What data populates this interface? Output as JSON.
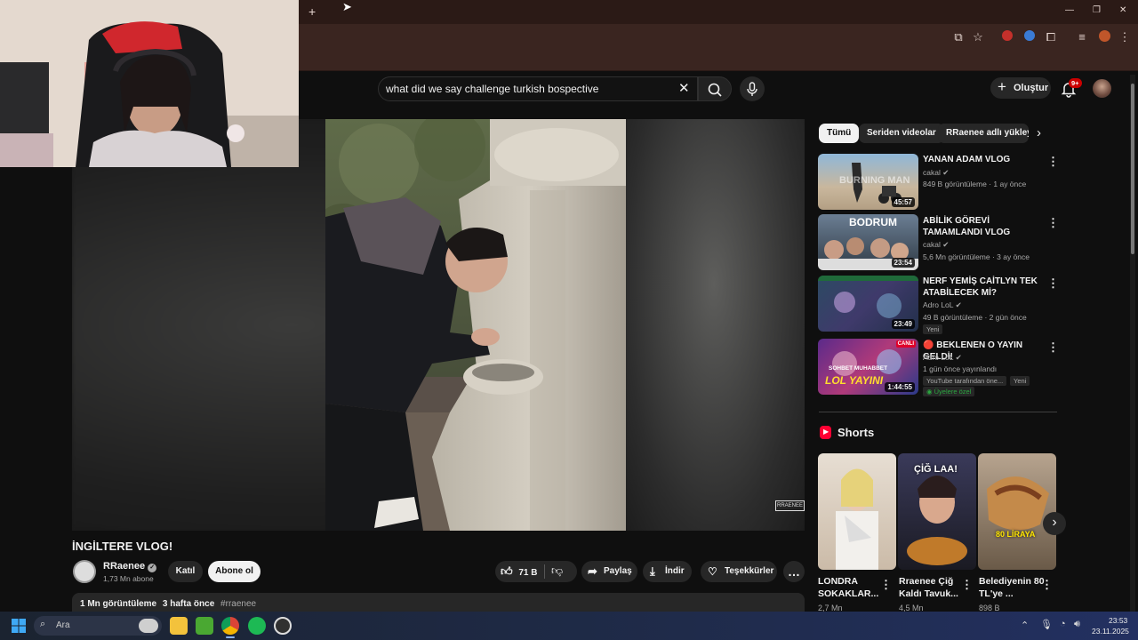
{
  "browser": {
    "new_tab": "+",
    "window_controls": [
      "—",
      "❐",
      "✕"
    ]
  },
  "search": {
    "query": "what did we say challenge turkish bospective"
  },
  "header": {
    "create_label": "Oluştur",
    "notif_count": "9+"
  },
  "video": {
    "title": "İNGİLTERE VLOG!",
    "channel": "RRaenee",
    "subscribers": "1,73 Mn abone",
    "join_label": "Katıl",
    "subscribe_label": "Abone ol",
    "likes": "71 B",
    "share_label": "Paylaş",
    "download_label": "İndir",
    "thanks_label": "Teşekkürler",
    "views": "1 Mn görüntüleme",
    "age": "3 hafta önce",
    "hashtag": "#rraenee",
    "watermark": "RRAENEE"
  },
  "chips": [
    "Tümü",
    "Seriden videolar",
    "RRaenee adlı yükleyic"
  ],
  "recommendations": [
    {
      "title": "YANAN ADAM VLOG",
      "channel": "cakal",
      "meta": "849 B görüntüleme · 1 ay önce",
      "duration": "45:57",
      "thumb_text": "BURNING MAN"
    },
    {
      "title": "ABİLİK GÖREVİ TAMAMLANDI VLOG",
      "channel": "cakal",
      "meta": "5,6 Mn görüntüleme · 3 ay önce",
      "duration": "23:54",
      "thumb_text": "BODRUM"
    },
    {
      "title": "NERF YEMİŞ CAİTLYN TEK ATABİLECEK Mİ?",
      "channel": "Adro LoL",
      "meta": "49 B görüntüleme · 2 gün önce",
      "duration": "23:49",
      "badge": "Yeni"
    },
    {
      "title": "🔴 BEKLENEN O YAYIN GELDİ!",
      "channel": "Adro LoL",
      "meta": "1 gün önce yayınlandı",
      "duration": "1:44:55",
      "badge1": "YouTube tarafından öne...",
      "badge2": "Yeni",
      "members": "Üyelere özel",
      "thumb_text": "LOL YAYINI",
      "thumb_text2": "SOHBET MUHABBET",
      "live": "CANLI"
    }
  ],
  "shorts": {
    "heading": "Shorts",
    "items": [
      {
        "title": "LONDRA SOKAKLAR...",
        "views": "2,7 Mn"
      },
      {
        "title": "Rraenee Çiğ Kaldı Tavuk...",
        "views": "4,5 Mn",
        "thumb_text": "ÇİĞ LAA!"
      },
      {
        "title": "Belediyenin 80 TL'ye ...",
        "views": "898 B",
        "thumb_text": "80 LİRAYA"
      }
    ]
  },
  "taskbar": {
    "search_label": "Ara",
    "time": "23:53",
    "date": "23.11.2025"
  }
}
